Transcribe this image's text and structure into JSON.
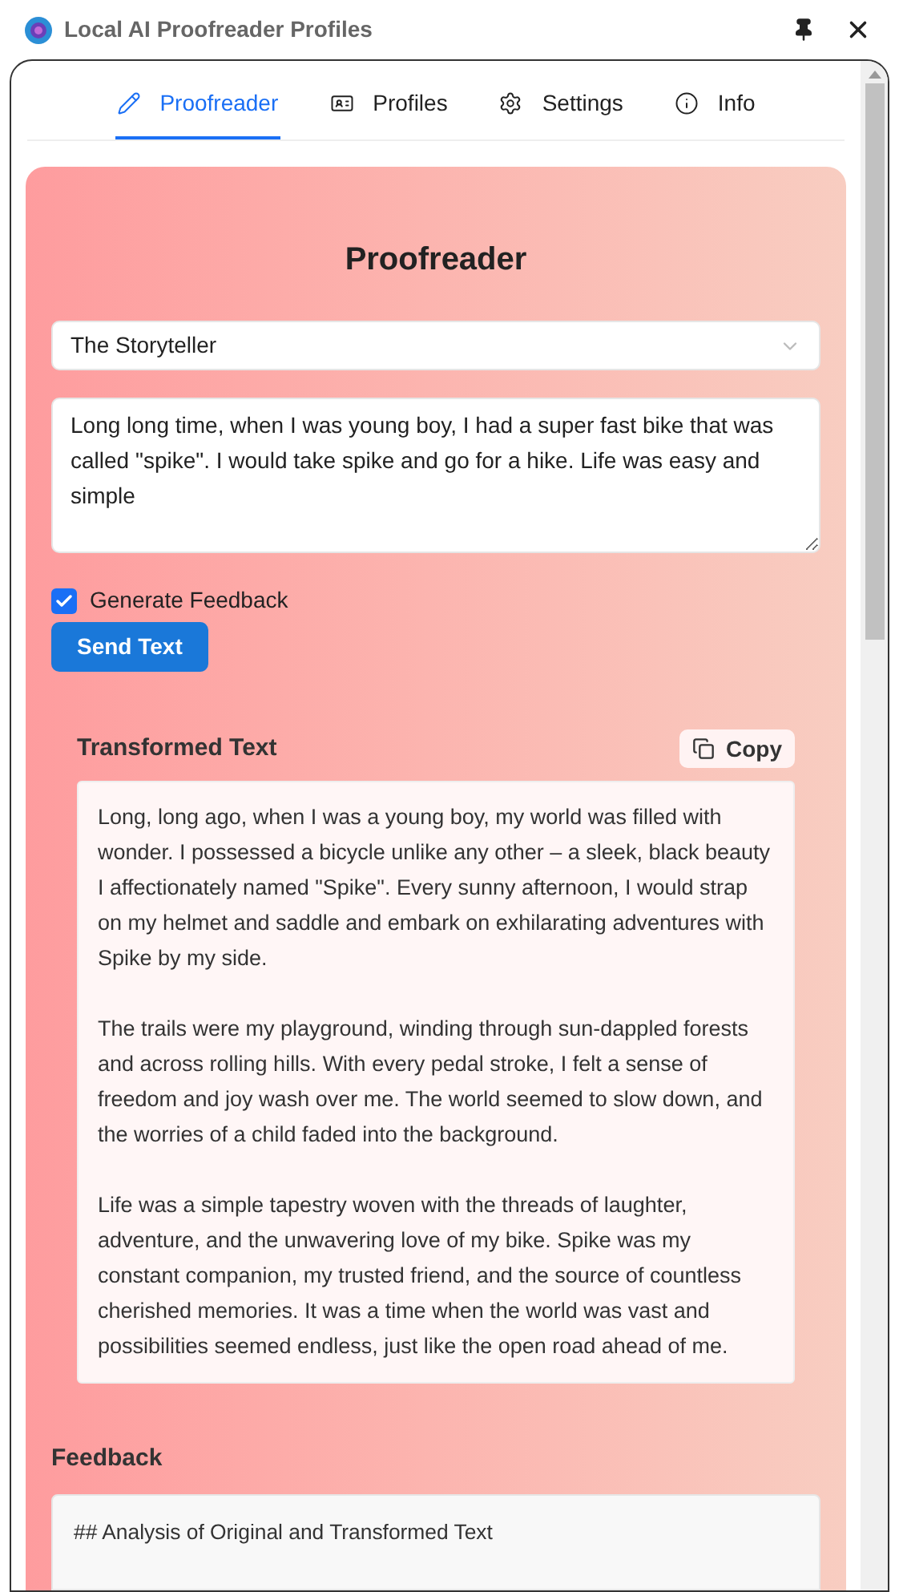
{
  "window": {
    "title": "Local AI Proofreader Profiles"
  },
  "tabs": [
    {
      "label": "Proofreader",
      "kind": "edit",
      "selected": true
    },
    {
      "label": "Profiles",
      "kind": "profiles",
      "selected": false
    },
    {
      "label": "Settings",
      "kind": "settings",
      "selected": false
    },
    {
      "label": "Info",
      "kind": "info",
      "selected": false
    }
  ],
  "panel": {
    "title": "Proofreader",
    "profile_select": {
      "value": "The Storyteller"
    },
    "input": {
      "value": "Long long time, when I was young boy, I had a super fast bike that was called \"spike\". I would take spike and go for a hike. Life was easy and simple"
    },
    "generate_feedback": {
      "label": "Generate Feedback",
      "checked": true
    },
    "send_button": "Send Text",
    "transformed": {
      "title": "Transformed Text",
      "copy_button": "Copy",
      "paragraphs": [
        "Long, long ago, when I was a young boy, my world was filled with wonder. I possessed a bicycle unlike any other – a sleek, black beauty I affectionately named \"Spike\". Every sunny afternoon, I would strap on my helmet and saddle and embark on exhilarating adventures with Spike by my side.",
        "The trails were my playground, winding through sun-dappled forests and across rolling hills. With every pedal stroke, I felt a sense of freedom and joy wash over me. The world seemed to slow down, and the worries of a child faded into the background.",
        "Life was a simple tapestry woven with the threads of laughter, adventure, and the unwavering love of my bike. Spike was my constant companion, my trusted friend, and the source of countless cherished memories. It was a time when the world was vast and possibilities seemed endless, just like the open road ahead of me."
      ]
    },
    "feedback": {
      "title": "Feedback",
      "text": "## Analysis of Original and Transformed Text"
    }
  }
}
